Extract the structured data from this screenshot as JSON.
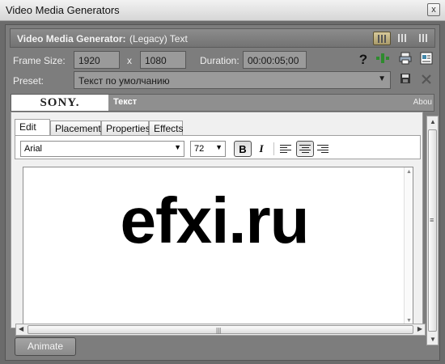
{
  "window": {
    "title": "Video Media Generators",
    "close_glyph": "x"
  },
  "header": {
    "label": "Video Media Generator:",
    "value": "(Legacy) Text"
  },
  "frame_size": {
    "label": "Frame Size:",
    "width": "1920",
    "separator": "x",
    "height": "1080"
  },
  "duration": {
    "label": "Duration:",
    "value": "00:00:05;00"
  },
  "preset": {
    "label": "Preset:",
    "value": "Текст по умолчанию"
  },
  "plugin_bar": {
    "brand": "SONY.",
    "title": "Текст",
    "about": "Abou"
  },
  "tabs": [
    {
      "label": "Edit"
    },
    {
      "label": "Placement"
    },
    {
      "label": "Properties"
    },
    {
      "label": "Effects"
    }
  ],
  "toolbar": {
    "font": "Arial",
    "size": "72",
    "bold": "B",
    "italic": "I"
  },
  "editor": {
    "text": "efxi.ru"
  },
  "buttons": {
    "animate": "Animate",
    "help": "?"
  },
  "colors": {
    "panel": "#7d7d7d",
    "active_view": "#c8b98a"
  }
}
